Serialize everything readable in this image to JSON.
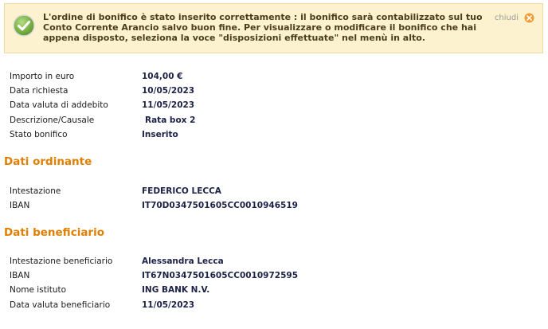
{
  "alert": {
    "message": "L'ordine di bonifico è stato inserito correttamente : il bonifico sarà contabilizzato sul tuo Conto Corrente Arancio salvo buon fine. Per visualizzare o modificare il bonifico che hai appena disposto, seleziona la voce \"disposizioni effettuate\" nel menù in alto.",
    "close_label": "chiudi"
  },
  "summary": [
    {
      "label": "Importo in euro",
      "value": "104,00 €"
    },
    {
      "label": "Data richiesta",
      "value": "10/05/2023"
    },
    {
      "label": "Data valuta di addebito",
      "value": "11/05/2023"
    },
    {
      "label": "Descrizione/Causale",
      "value": "Rata box 2"
    },
    {
      "label": "Stato bonifico",
      "value": "Inserito"
    }
  ],
  "ordinante": {
    "title": "Dati ordinante",
    "rows": [
      {
        "label": "Intestazione",
        "value": "FEDERICO LECCA"
      },
      {
        "label": "IBAN",
        "value": "IT70D0347501605CC0010946519"
      }
    ]
  },
  "beneficiario": {
    "title": "Dati beneficiario",
    "rows": [
      {
        "label": "Intestazione beneficiario",
        "value": "Alessandra Lecca"
      },
      {
        "label": "IBAN",
        "value": "IT67N0347501605CC0010972595"
      },
      {
        "label": "Nome istituto",
        "value": "ING BANK N.V."
      },
      {
        "label": "Data valuta beneficiario",
        "value": "11/05/2023"
      }
    ]
  },
  "colors": {
    "alert_bg": "#fdf2cf",
    "section_title": "#e07f00",
    "value_text": "#1c2247",
    "success_icon": "#7ab648",
    "close_icon": "#f39c33"
  }
}
